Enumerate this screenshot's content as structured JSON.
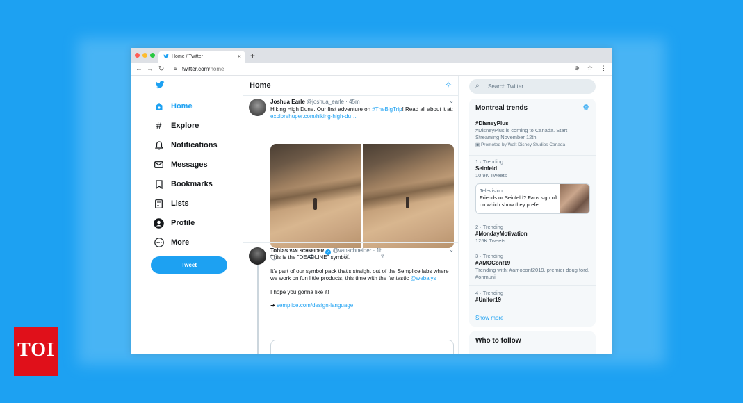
{
  "browser": {
    "tab_title": "Home / Twitter",
    "tab_close": "×",
    "new_tab": "+",
    "nav": {
      "back": "←",
      "forward": "→",
      "reload": "↻"
    },
    "url_host": "twitter.com",
    "url_path": "/home",
    "right_icons": [
      "⊕",
      "☆",
      "⋮"
    ],
    "traffic_colors": [
      "#ff5f57",
      "#febc2e",
      "#28c840"
    ]
  },
  "sidebar": {
    "items": [
      {
        "label": "Home",
        "icon": "home-icon",
        "active": true
      },
      {
        "label": "Explore",
        "icon": "hashtag-icon"
      },
      {
        "label": "Notifications",
        "icon": "bell-icon"
      },
      {
        "label": "Messages",
        "icon": "envelope-icon"
      },
      {
        "label": "Bookmarks",
        "icon": "bookmark-icon"
      },
      {
        "label": "Lists",
        "icon": "list-icon"
      },
      {
        "label": "Profile",
        "icon": "profile-icon"
      },
      {
        "label": "More",
        "icon": "more-icon"
      }
    ],
    "tweet_button": "Tweet"
  },
  "feed": {
    "title": "Home",
    "tweets": [
      {
        "name": "Joshua Earle",
        "handle": "@joshua_earle",
        "time": "45m",
        "text_before": "Hiking High Dune. Our first adventure on ",
        "hashtag": "#TheBigTrip",
        "text_after": "! Read all about it at:",
        "link": "explorehuper.com/hiking-high-du…"
      },
      {
        "name": "Tobias",
        "name_smallcaps": "van schneider",
        "handle": "@vanschneider",
        "time": "1h",
        "line1": "This is the \"DEADLINE\" symbol.",
        "line2_before": "It's part of our symbol pack that's straight out of the Semplice labs where we work on fun little products, this time with the fantastic ",
        "mention": "@webalys",
        "line3": "I hope you gonna like it!",
        "arrow": "➜ ",
        "link": "semplice.com/design-language"
      }
    ]
  },
  "right": {
    "search_placeholder": "Search Twitter",
    "trends_title": "Montreal trends",
    "promoted": {
      "name": "#DisneyPlus",
      "desc": "#DisneyPlus is coming to Canada. Start Streaming November 12th",
      "promoted_by": "Promoted by Walt Disney Studios Canada"
    },
    "trends": [
      {
        "meta": "1 · Trending",
        "name": "Seinfeld",
        "sub": "10.9K Tweets"
      },
      {
        "meta": "2 · Trending",
        "name": "#MondayMotivation",
        "sub": "125K Tweets"
      },
      {
        "meta": "3 · Trending",
        "name": "#AMOConf19",
        "sub": "Trending with: #amoconf2019, premier doug ford, #onmuni"
      },
      {
        "meta": "4 · Trending",
        "name": "#Unifor19",
        "sub": ""
      }
    ],
    "news": {
      "category": "Television",
      "headline": "Friends or Seinfeld? Fans sign off on which show they prefer"
    },
    "show_more": "Show more",
    "who_to_follow": "Who to follow"
  },
  "watermark": {
    "text": "TOI"
  },
  "colors": {
    "accent": "#1da1f2",
    "text": "#14171a",
    "muted": "#657786"
  }
}
